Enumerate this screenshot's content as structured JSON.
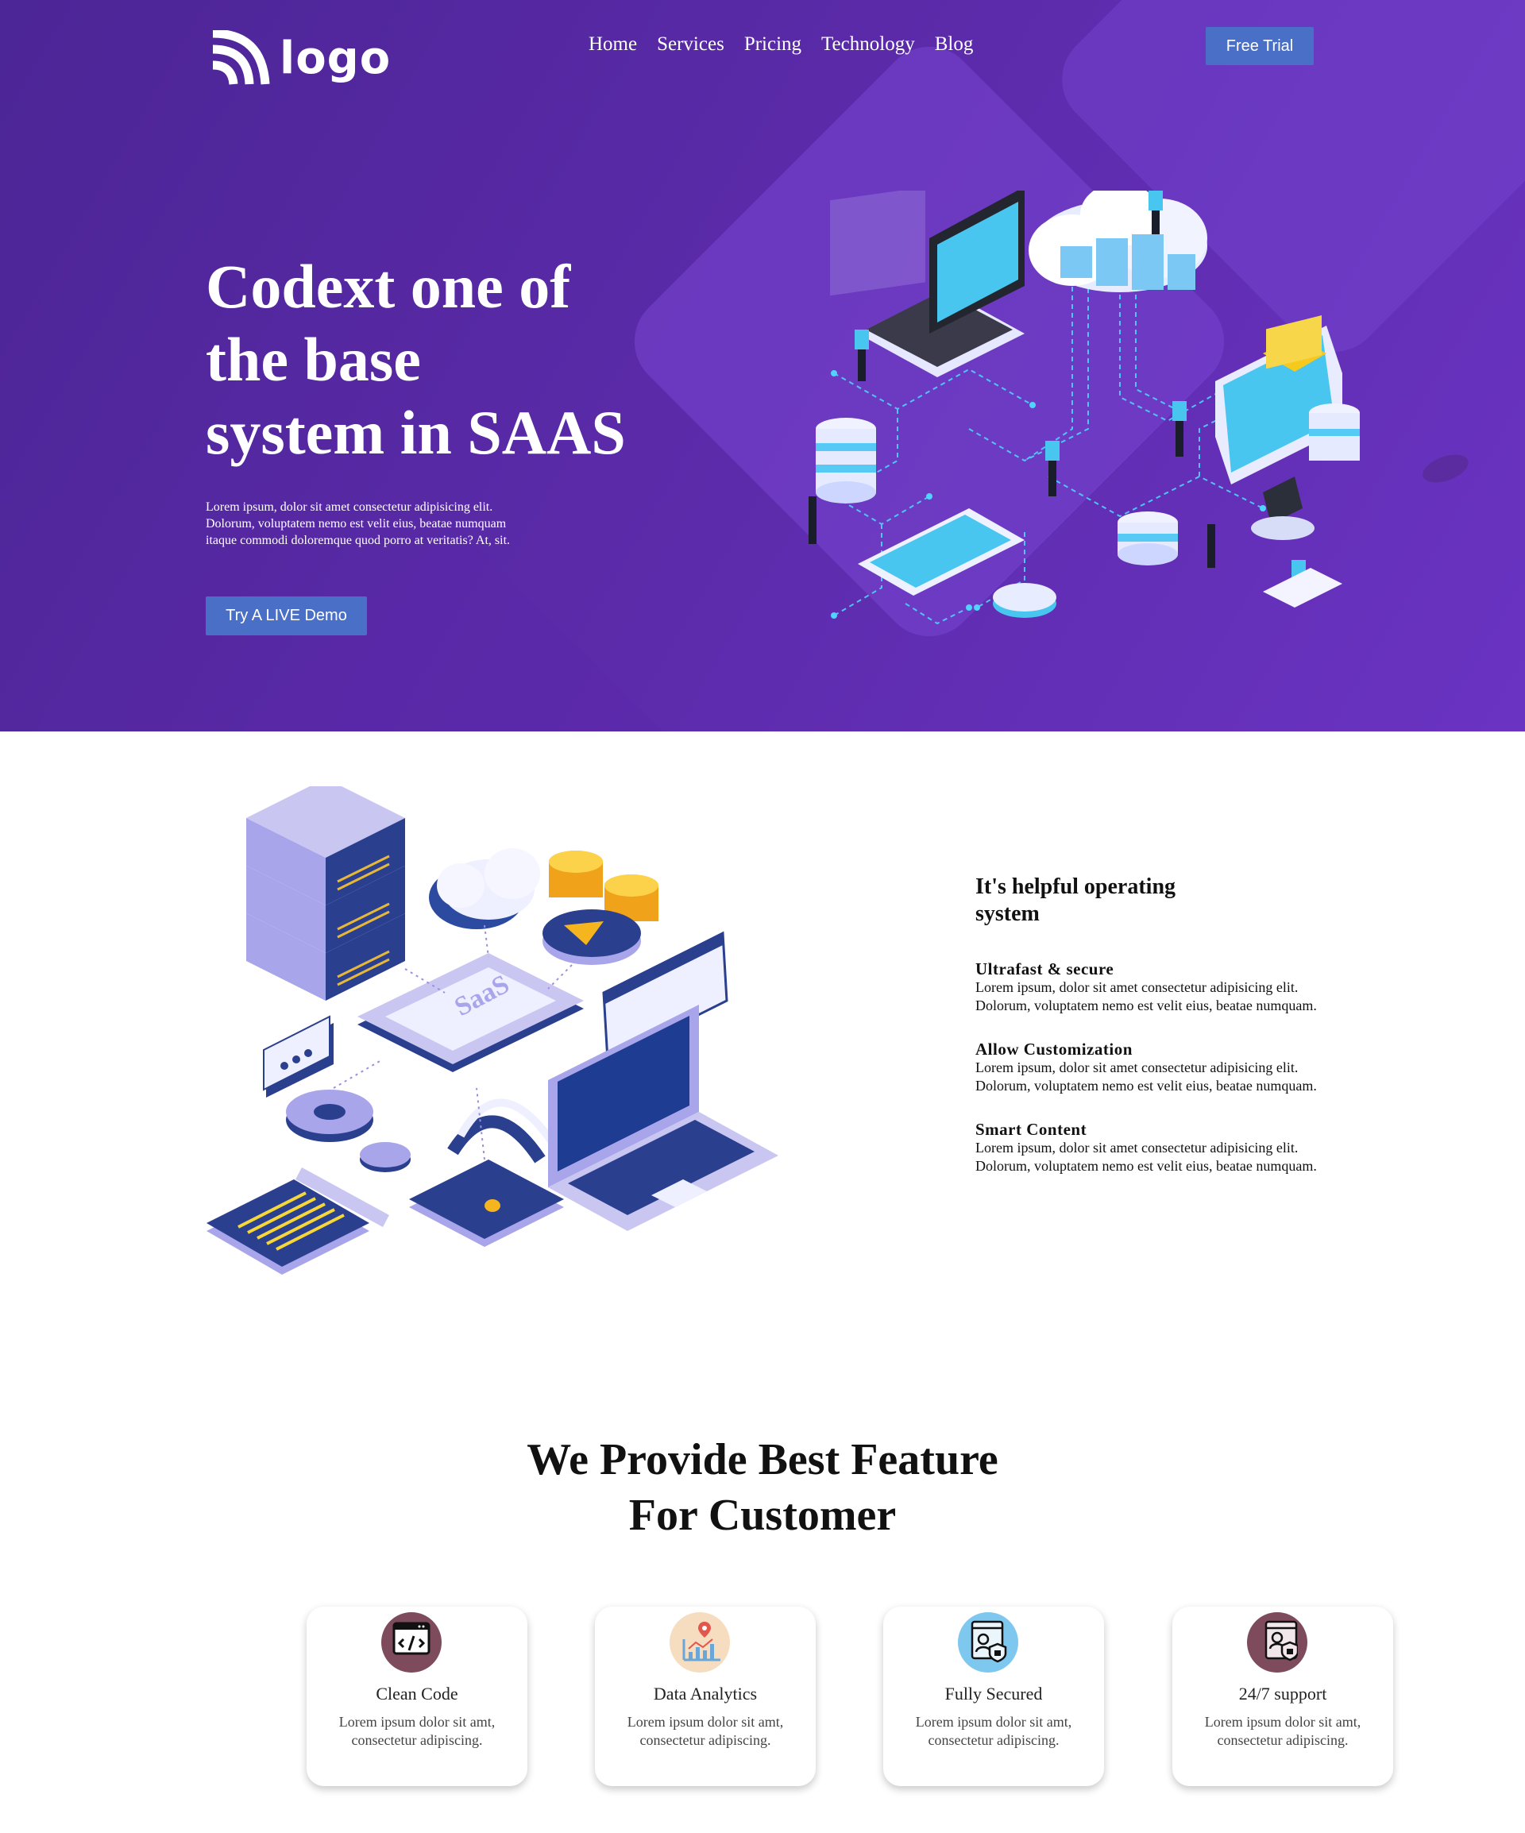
{
  "brand": {
    "logo_text": "logo"
  },
  "nav": {
    "links": [
      "Home",
      "Services",
      "Pricing",
      "Technology",
      "Blog"
    ],
    "cta": "Free Trial"
  },
  "hero": {
    "title_lines": [
      "Codext one of",
      "the base",
      "system in SAAS"
    ],
    "description_lines": [
      "Lorem ipsum, dolor sit amet consectetur adipisicing elit.",
      "Dolorum, voluptatem nemo est velit eius, beatae numquam",
      "itaque commodi doloremque quod porro at veritatis? At, sit."
    ],
    "cta": "Try A LIVE Demo"
  },
  "about": {
    "illustration_label": "SaaS",
    "title_lines": [
      "It's helpful operating",
      "system"
    ],
    "features": [
      {
        "title": "Ultrafast & secure",
        "lines": [
          "Lorem ipsum, dolor sit amet consectetur adipisicing elit.",
          "Dolorum, voluptatem nemo est velit eius, beatae numquam."
        ]
      },
      {
        "title": "Allow Customization",
        "lines": [
          "Lorem ipsum, dolor sit amet consectetur adipisicing elit.",
          "Dolorum, voluptatem nemo est velit eius, beatae numquam."
        ]
      },
      {
        "title": "Smart Content",
        "lines": [
          "Lorem ipsum, dolor sit amet consectetur adipisicing elit.",
          "Dolorum, voluptatem nemo est velit eius, beatae numquam."
        ]
      }
    ]
  },
  "features_section": {
    "title_lines": [
      "We Provide Best Feature",
      "For Customer"
    ],
    "cards": [
      {
        "title": "Clean Code",
        "desc_lines": [
          "Lorem ipsum dolor sit amt,",
          "consectetur adipiscing."
        ],
        "icon": "code-icon",
        "color": "#7d4b5c"
      },
      {
        "title": "Data Analytics",
        "desc_lines": [
          "Lorem ipsum dolor sit amt,",
          "consectetur adipiscing."
        ],
        "icon": "analytics-icon",
        "color": "#f7ddc0"
      },
      {
        "title": "Fully Secured",
        "desc_lines": [
          "Lorem ipsum dolor sit amt,",
          "consectetur adipiscing."
        ],
        "icon": "secure-profile-icon",
        "color": "#7ec8f0"
      },
      {
        "title": "24/7 support",
        "desc_lines": [
          "Lorem ipsum dolor sit amt,",
          "consectetur adipiscing."
        ],
        "icon": "support-shield-icon",
        "color": "#7d4b5c"
      }
    ]
  },
  "colors": {
    "hero_bg": "#5a2aa8",
    "button": "#4a6fc7",
    "accent_cyan": "#3fd0f5"
  }
}
